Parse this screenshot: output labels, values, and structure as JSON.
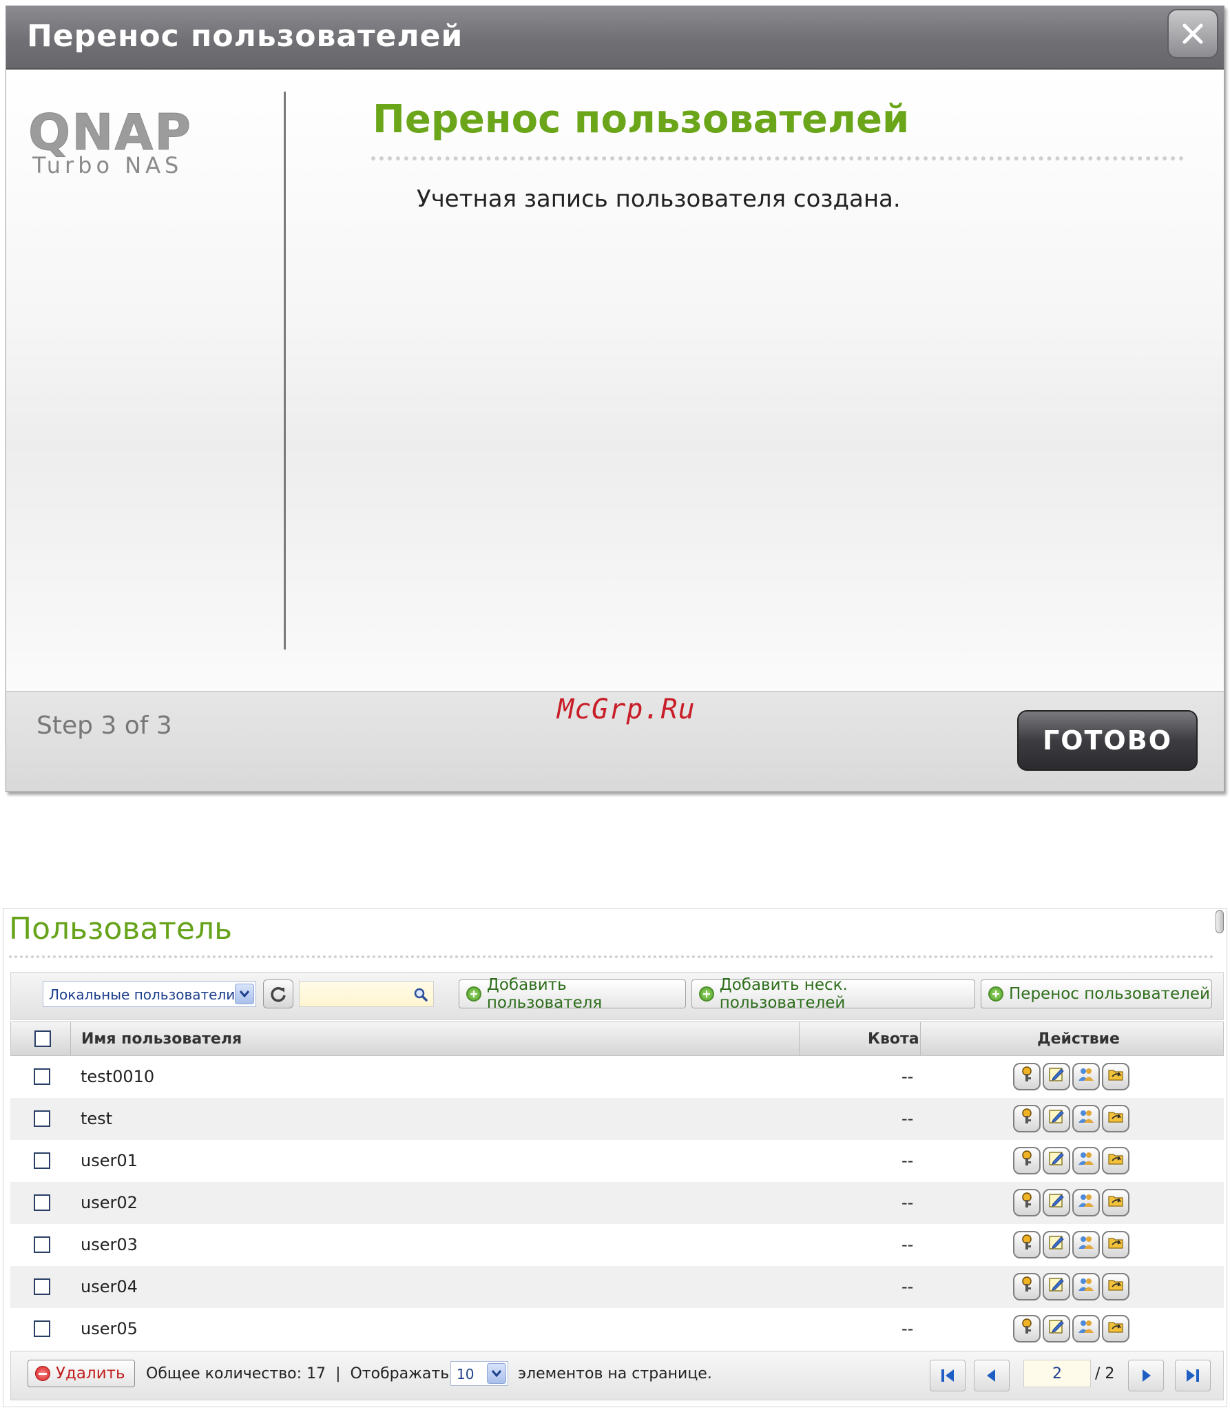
{
  "dialog": {
    "title": "Перенос пользователей",
    "logo_brand": "QNAP",
    "logo_sub": "Turbo NAS",
    "heading": "Перенос пользователей",
    "message": "Учетная запись пользователя создана.",
    "step": "Step 3 of 3",
    "watermark": "McGrp.Ru",
    "done_label": "ГОТОВО",
    "close_icon": "close-icon"
  },
  "users_panel": {
    "title": "Пользователь",
    "toolbar": {
      "filter_value": "Локальные пользователи",
      "search_value": "",
      "add_user": "Добавить пользователя",
      "add_multiple": "Добавить неск. пользователей",
      "migrate": "Перенос пользователей"
    },
    "columns": {
      "name": "Имя пользователя",
      "quota": "Квота",
      "action": "Действие"
    },
    "rows": [
      {
        "name": "test0010",
        "quota": "--"
      },
      {
        "name": "test",
        "quota": "--"
      },
      {
        "name": "user01",
        "quota": "--"
      },
      {
        "name": "user02",
        "quota": "--"
      },
      {
        "name": "user03",
        "quota": "--"
      },
      {
        "name": "user04",
        "quota": "--"
      },
      {
        "name": "user05",
        "quota": "--"
      }
    ],
    "action_icons": [
      "key-icon",
      "edit-icon",
      "group-icon",
      "folder-share-icon"
    ],
    "footer": {
      "delete": "Удалить",
      "total_label": "Общее количество:",
      "total_value": "17",
      "separator": "|",
      "show_label": "Отображать",
      "per_page": "10",
      "per_page_suffix": "элементов на странице.",
      "current_page": "2",
      "page_total": "/ 2"
    }
  },
  "colors": {
    "accent_green": "#6aa51a",
    "titlebar_grey": "#707075",
    "watermark_red": "#c81e28"
  }
}
